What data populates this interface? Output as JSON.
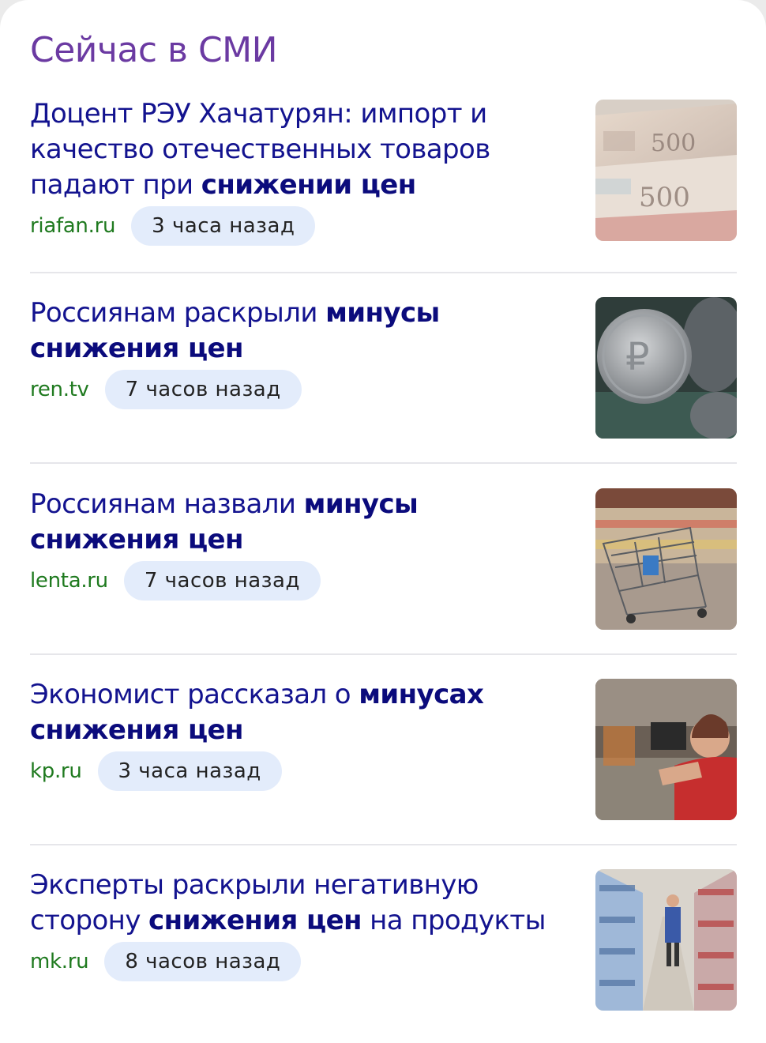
{
  "section": {
    "title": "Сейчас в СМИ"
  },
  "news": [
    {
      "title_parts": [
        {
          "text": "Доцент РЭУ Хачатурян: импорт и качество отечественных товаров падают при ",
          "bold": false
        },
        {
          "text": "снижении цен",
          "bold": true
        }
      ],
      "source": "riafan.ru",
      "time": "3 часа назад",
      "image_icon": "banknotes-500-rubles-image"
    },
    {
      "title_parts": [
        {
          "text": "Россиянам раскрыли ",
          "bold": false
        },
        {
          "text": "минусы снижения цен",
          "bold": true
        }
      ],
      "source": "ren.tv",
      "time": "7 часов назад",
      "image_icon": "ruble-coin-image"
    },
    {
      "title_parts": [
        {
          "text": "Россиянам назвали ",
          "bold": false
        },
        {
          "text": "минусы снижения цен",
          "bold": true
        }
      ],
      "source": "lenta.ru",
      "time": "7 часов назад",
      "image_icon": "shopping-cart-image"
    },
    {
      "title_parts": [
        {
          "text": "Экономист рассказал о ",
          "bold": false
        },
        {
          "text": "минусах снижения цен",
          "bold": true
        }
      ],
      "source": "kp.ru",
      "time": "3 часа назад",
      "image_icon": "cashier-image"
    },
    {
      "title_parts": [
        {
          "text": "Эксперты раскрыли негативную сторону ",
          "bold": false
        },
        {
          "text": "снижения цен",
          "bold": true
        },
        {
          "text": " на продукты",
          "bold": false
        }
      ],
      "source": "mk.ru",
      "time": "8 часов назад",
      "image_icon": "supermarket-aisle-image"
    }
  ],
  "colors": {
    "heading": "#6b3aa2",
    "title": "#13138f",
    "source": "#1f7a1f",
    "badge_bg": "#e3ecfb"
  }
}
